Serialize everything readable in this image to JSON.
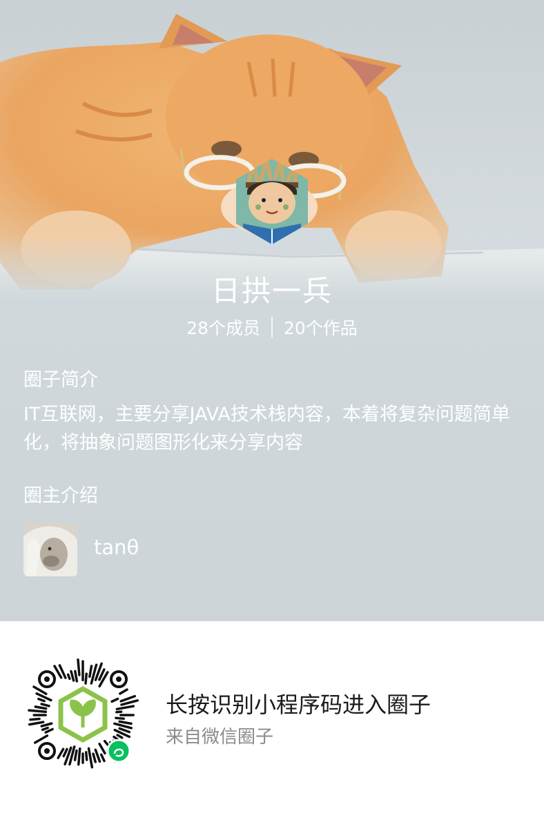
{
  "circle": {
    "name": "日拱一兵",
    "members": "28个成员",
    "works": "20个作品"
  },
  "sections": {
    "intro_title": "圈子简介",
    "intro_text": "IT互联网，主要分享JAVA技术栈内容，本着将复杂问题简单化，将抽象问题图形化来分享内容",
    "owner_title": "圈主介绍"
  },
  "owner": {
    "name": "tanθ"
  },
  "footer": {
    "prompt": "长按识别小程序码进入圈子",
    "source": "来自微信圈子"
  },
  "icons": {
    "qr": "mini-program-code",
    "badge": "mini-program-link-icon"
  },
  "colors": {
    "brand_green": "#07c160",
    "sprout_green": "#8bc34a"
  }
}
